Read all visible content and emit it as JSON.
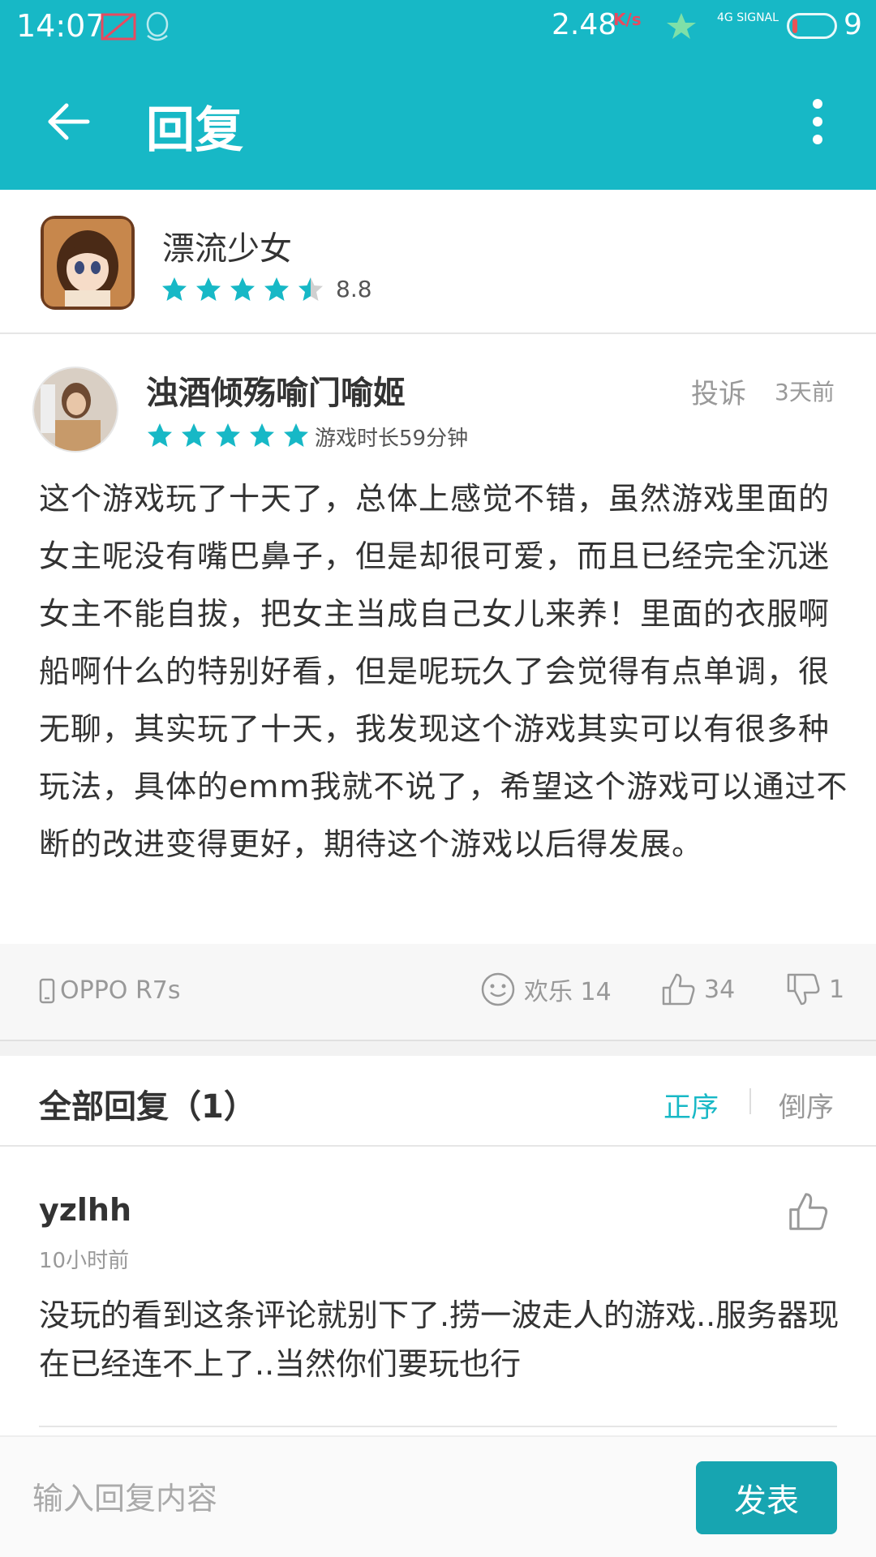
{
  "status_bar": {
    "time": "14:07",
    "speed": "2.48",
    "speed_unit": "K/s",
    "network": "4G SIGNAL",
    "battery": "9"
  },
  "app_bar": {
    "title": "回复",
    "back_icon": "arrow-left-icon",
    "menu_icon": "more-vert-icon"
  },
  "game": {
    "name": "漂流少女",
    "rating": 4.5,
    "score": "8.8"
  },
  "review": {
    "user": "浊酒倾殇喻门喻姬",
    "report_label": "投诉",
    "time": "3天前",
    "rating": 5,
    "play_time": "游戏时长59分钟",
    "body": "这个游戏玩了十天了，总体上感觉不错，虽然游戏里面的女主呢没有嘴巴鼻子，但是却很可爱，而且已经完全沉迷女主不能自拔，把女主当成自己女儿来养！里面的衣服啊船啊什么的特别好看，但是呢玩久了会觉得有点单调，很无聊，其实玩了十天，我发现这个游戏其实可以有很多种玩法，具体的emm我就不说了，希望这个游戏可以通过不断的改进变得更好，期待这个游戏以后得发展。",
    "device": "OPPO R7s",
    "fun_label": "欢乐 14",
    "likes": "34",
    "dislikes": "1"
  },
  "replies": {
    "header": "全部回复（1）",
    "sort_asc": "正序",
    "sort_desc": "倒序",
    "items": [
      {
        "user": "yzlhh",
        "time": "10小时前",
        "body": "没玩的看到这条评论就别下了.捞一波走人的游戏..服务器现在已经连不上了..当然你们要玩也行"
      }
    ]
  },
  "input": {
    "placeholder": "输入回复内容",
    "send_label": "发表"
  },
  "colors": {
    "primary": "#17b8c6",
    "star": "#17b8c6",
    "send_button": "#17a5b1"
  }
}
